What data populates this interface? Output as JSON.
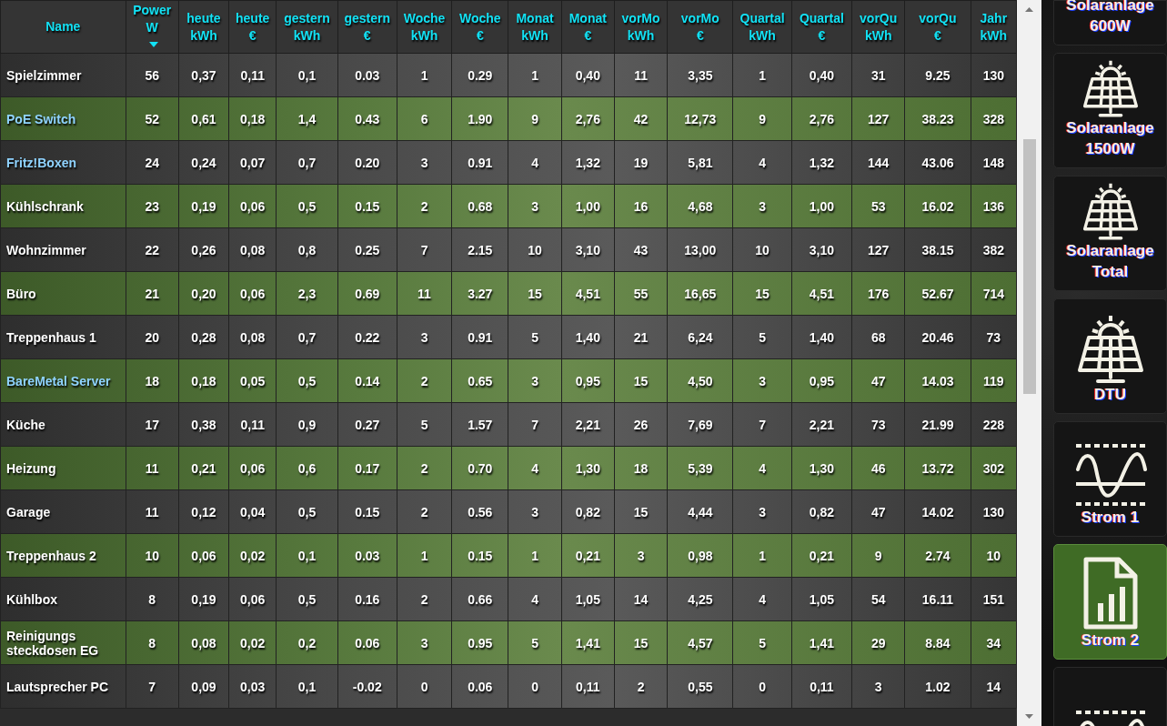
{
  "table": {
    "columns": [
      {
        "label": "Name",
        "sorted": false
      },
      {
        "label": "Power W",
        "sorted": true
      },
      {
        "label": "heute kWh",
        "sorted": false
      },
      {
        "label": "heute €",
        "sorted": false
      },
      {
        "label": "gestern kWh",
        "sorted": false
      },
      {
        "label": "gestern €",
        "sorted": false
      },
      {
        "label": "Woche kWh",
        "sorted": false
      },
      {
        "label": "Woche €",
        "sorted": false
      },
      {
        "label": "Monat kWh",
        "sorted": false
      },
      {
        "label": "Monat €",
        "sorted": false
      },
      {
        "label": "vorMo kWh",
        "sorted": false
      },
      {
        "label": "vorMo €",
        "sorted": false
      },
      {
        "label": "Quartal kWh",
        "sorted": false
      },
      {
        "label": "Quartal €",
        "sorted": false
      },
      {
        "label": "vorQu kWh",
        "sorted": false
      },
      {
        "label": "vorQu €",
        "sorted": false
      },
      {
        "label": "Jahr kWh",
        "sorted": false
      }
    ],
    "rows": [
      {
        "link": false,
        "cells": [
          "Spielzimmer",
          "56",
          "0,37",
          "0,11",
          "0,1",
          "0.03",
          "1",
          "0.29",
          "1",
          "0,40",
          "11",
          "3,35",
          "1",
          "0,40",
          "31",
          "9.25",
          "130"
        ]
      },
      {
        "link": true,
        "cells": [
          "PoE Switch",
          "52",
          "0,61",
          "0,18",
          "1,4",
          "0.43",
          "6",
          "1.90",
          "9",
          "2,76",
          "42",
          "12,73",
          "9",
          "2,76",
          "127",
          "38.23",
          "328"
        ]
      },
      {
        "link": true,
        "cells": [
          "Fritz!Boxen",
          "24",
          "0,24",
          "0,07",
          "0,7",
          "0.20",
          "3",
          "0.91",
          "4",
          "1,32",
          "19",
          "5,81",
          "4",
          "1,32",
          "144",
          "43.06",
          "148"
        ]
      },
      {
        "link": false,
        "cells": [
          "Kühlschrank",
          "23",
          "0,19",
          "0,06",
          "0,5",
          "0.15",
          "2",
          "0.68",
          "3",
          "1,00",
          "16",
          "4,68",
          "3",
          "1,00",
          "53",
          "16.02",
          "136"
        ]
      },
      {
        "link": false,
        "cells": [
          "Wohnzimmer",
          "22",
          "0,26",
          "0,08",
          "0,8",
          "0.25",
          "7",
          "2.15",
          "10",
          "3,10",
          "43",
          "13,00",
          "10",
          "3,10",
          "127",
          "38.15",
          "382"
        ]
      },
      {
        "link": false,
        "cells": [
          "Büro",
          "21",
          "0,20",
          "0,06",
          "2,3",
          "0.69",
          "11",
          "3.27",
          "15",
          "4,51",
          "55",
          "16,65",
          "15",
          "4,51",
          "176",
          "52.67",
          "714"
        ]
      },
      {
        "link": false,
        "cells": [
          "Treppenhaus 1",
          "20",
          "0,28",
          "0,08",
          "0,7",
          "0.22",
          "3",
          "0.91",
          "5",
          "1,40",
          "21",
          "6,24",
          "5",
          "1,40",
          "68",
          "20.46",
          "73"
        ]
      },
      {
        "link": true,
        "cells": [
          "BareMetal Server",
          "18",
          "0,18",
          "0,05",
          "0,5",
          "0.14",
          "2",
          "0.65",
          "3",
          "0,95",
          "15",
          "4,50",
          "3",
          "0,95",
          "47",
          "14.03",
          "119"
        ]
      },
      {
        "link": false,
        "cells": [
          "Küche",
          "17",
          "0,38",
          "0,11",
          "0,9",
          "0.27",
          "5",
          "1.57",
          "7",
          "2,21",
          "26",
          "7,69",
          "7",
          "2,21",
          "73",
          "21.99",
          "228"
        ]
      },
      {
        "link": false,
        "cells": [
          "Heizung",
          "11",
          "0,21",
          "0,06",
          "0,6",
          "0.17",
          "2",
          "0.70",
          "4",
          "1,30",
          "18",
          "5,39",
          "4",
          "1,30",
          "46",
          "13.72",
          "302"
        ]
      },
      {
        "link": false,
        "cells": [
          "Garage",
          "11",
          "0,12",
          "0,04",
          "0,5",
          "0.15",
          "2",
          "0.56",
          "3",
          "0,82",
          "15",
          "4,44",
          "3",
          "0,82",
          "47",
          "14.02",
          "130"
        ]
      },
      {
        "link": false,
        "cells": [
          "Treppenhaus 2",
          "10",
          "0,06",
          "0,02",
          "0,1",
          "0.03",
          "1",
          "0.15",
          "1",
          "0,21",
          "3",
          "0,98",
          "1",
          "0,21",
          "9",
          "2.74",
          "10"
        ]
      },
      {
        "link": false,
        "cells": [
          "Kühlbox",
          "8",
          "0,19",
          "0,06",
          "0,5",
          "0.16",
          "2",
          "0.66",
          "4",
          "1,05",
          "14",
          "4,25",
          "4",
          "1,05",
          "54",
          "16.11",
          "151"
        ]
      },
      {
        "link": false,
        "cells": [
          "Reinigungs steckdosen EG",
          "8",
          "0,08",
          "0,02",
          "0,2",
          "0.06",
          "3",
          "0.95",
          "5",
          "1,41",
          "15",
          "4,57",
          "5",
          "1,41",
          "29",
          "8.84",
          "34"
        ]
      },
      {
        "link": false,
        "cells": [
          "Lautsprecher PC",
          "7",
          "0,09",
          "0,03",
          "0,1",
          "-0.02",
          "0",
          "0.06",
          "0",
          "0,11",
          "2",
          "0,55",
          "0",
          "0,11",
          "3",
          "1.02",
          "14"
        ]
      }
    ]
  },
  "sidebar": {
    "items": [
      {
        "label": "Solaranlage 600W",
        "selected": false
      },
      {
        "label": "Solaranlage 1500W",
        "kind": "solar",
        "selected": false
      },
      {
        "label": "Solaranlage Total",
        "kind": "solar",
        "selected": false
      },
      {
        "label": "DTU",
        "kind": "solar",
        "selected": false
      },
      {
        "label": "Strom 1",
        "kind": "wave",
        "selected": false
      },
      {
        "label": "Strom 2",
        "kind": "document",
        "selected": true
      },
      {
        "kind": "wave",
        "selected": false
      }
    ]
  }
}
